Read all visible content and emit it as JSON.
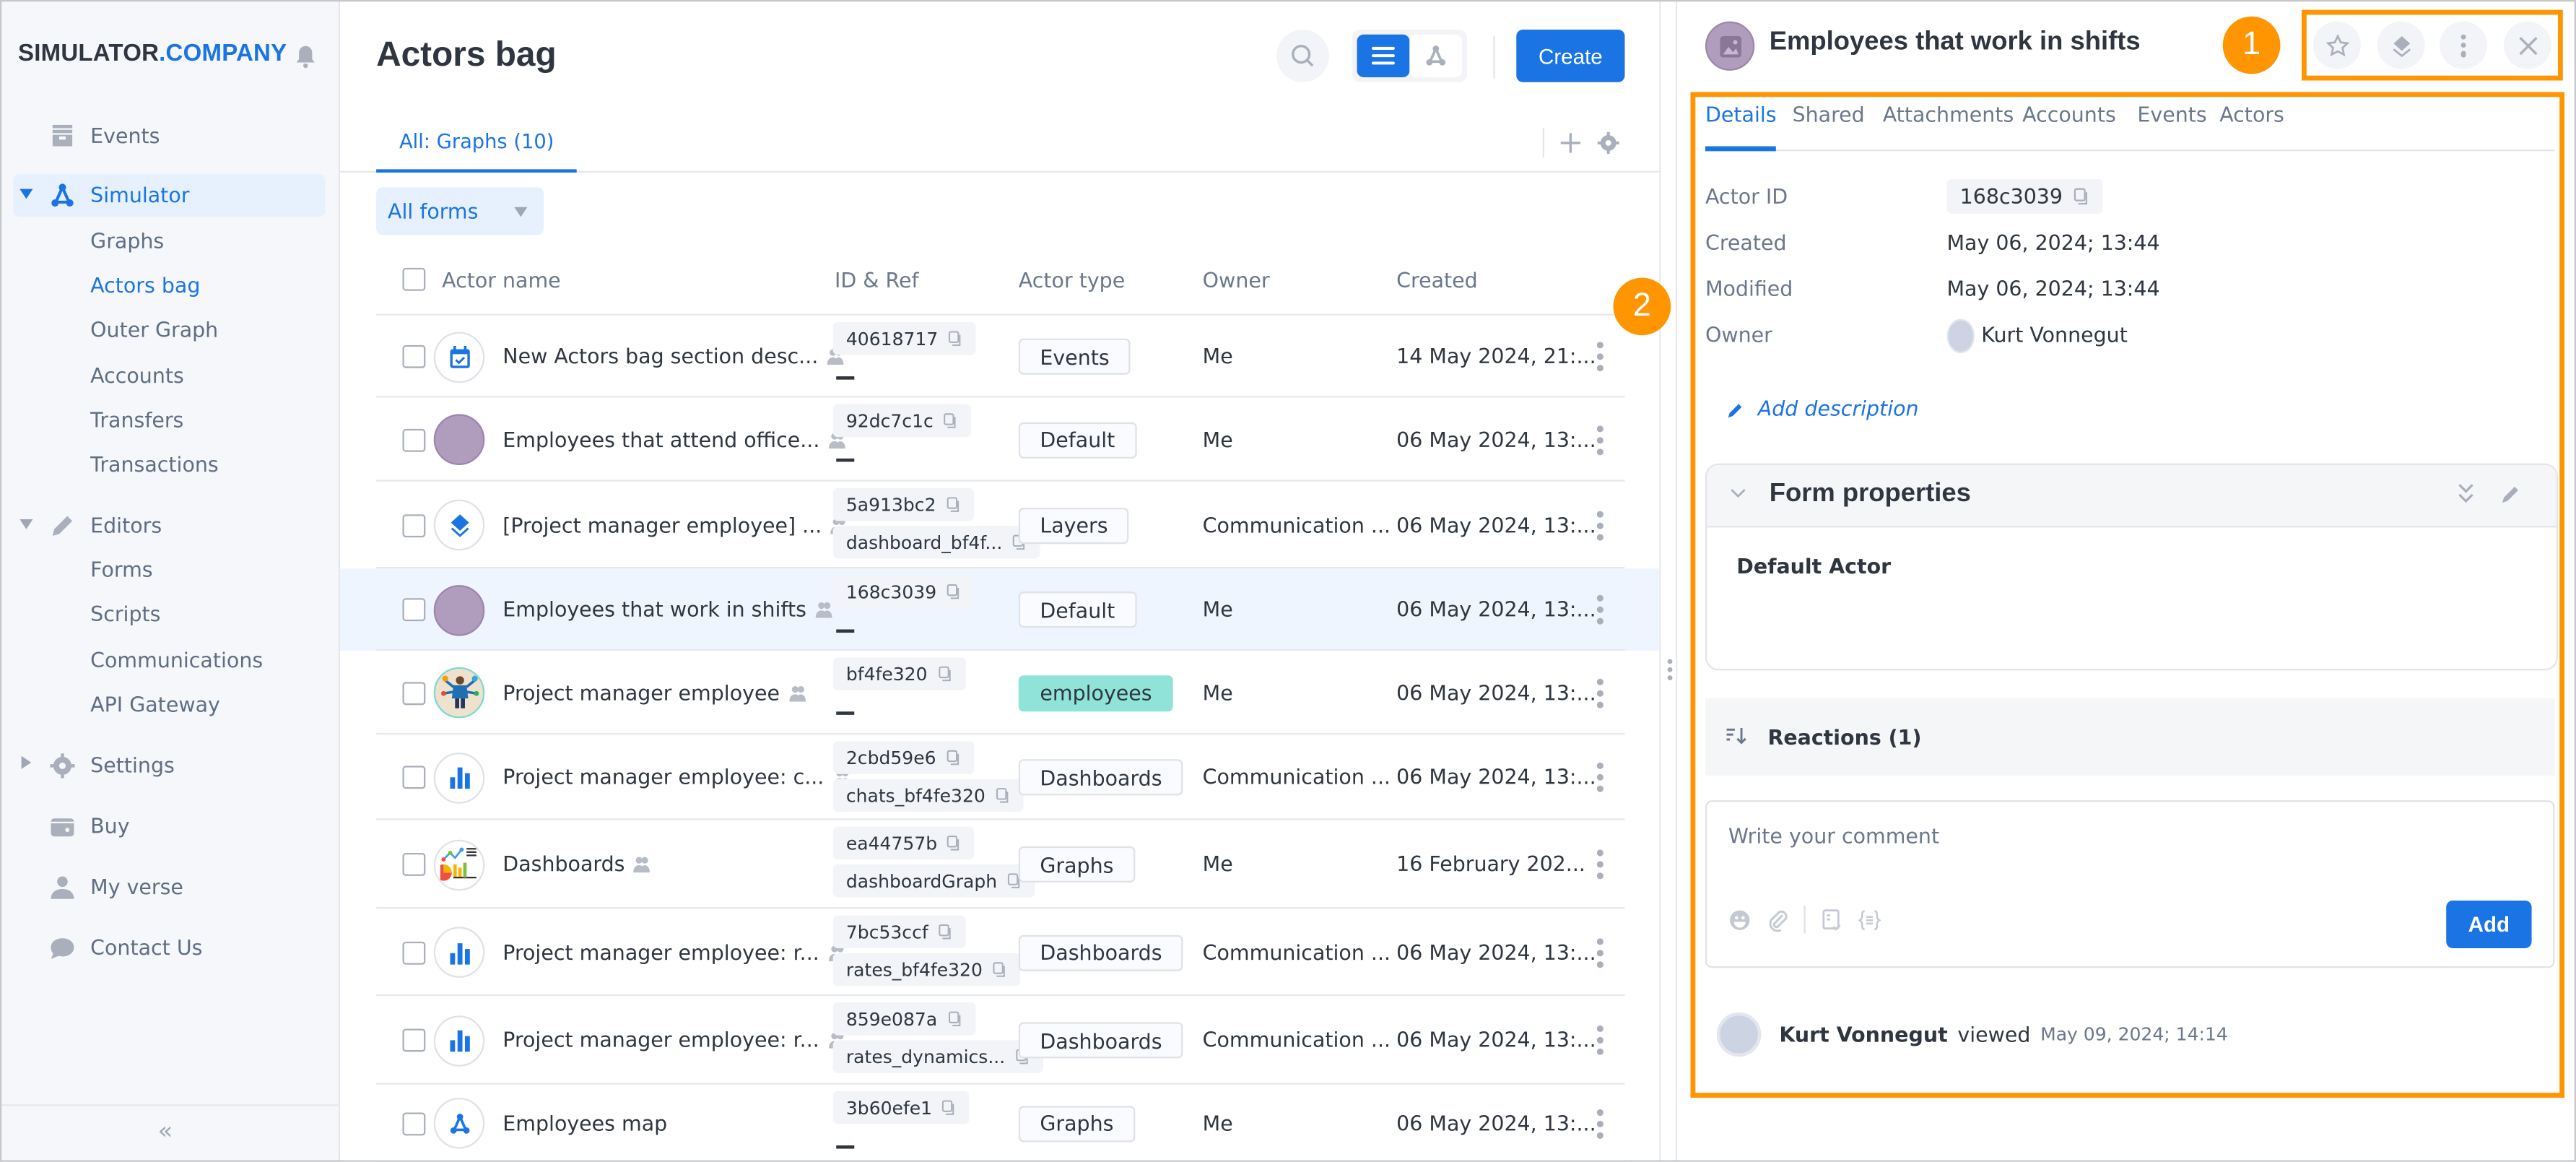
{
  "brand": {
    "part1": "SIMULATOR",
    "part2": ".COMPANY"
  },
  "sidebar": {
    "items": [
      {
        "label": "Events",
        "icon": "inbox-icon"
      },
      {
        "label": "Simulator",
        "icon": "graph-icon",
        "expanded": true,
        "active": true,
        "children": [
          "Graphs",
          "Actors bag",
          "Outer Graph",
          "Accounts",
          "Transfers",
          "Transactions"
        ]
      },
      {
        "label": "Editors",
        "icon": "pencil-icon",
        "expanded": true,
        "children": [
          "Forms",
          "Scripts",
          "Communications",
          "API Gateway"
        ]
      },
      {
        "label": "Settings",
        "icon": "gear-icon",
        "expanded": false
      },
      {
        "label": "Buy",
        "icon": "wallet-icon"
      },
      {
        "label": "My verse",
        "icon": "user-icon"
      },
      {
        "label": "Contact Us",
        "icon": "chat-icon"
      }
    ],
    "active_child": "Actors bag",
    "collapse_label": "«"
  },
  "main": {
    "title": "Actors bag",
    "create_label": "Create",
    "tab_label": "All: Graphs (10)",
    "filter_value": "All forms",
    "columns": [
      "Actor name",
      "ID & Ref",
      "Actor type",
      "Owner",
      "Created"
    ],
    "rows": [
      {
        "name": "New Actors bag section desc...",
        "avatar": "calendar-check-icon",
        "id": "40618717",
        "ref": "—",
        "type": "Events",
        "owner": "Me",
        "created": "14 May 2024, 21:..."
      },
      {
        "name": "Employees that attend office...",
        "avatar": "purple-circle",
        "id": "92dc7c1c",
        "ref": "—",
        "type": "Default",
        "owner": "Me",
        "created": "06 May 2024, 13:..."
      },
      {
        "name": "[Project manager employee] ...",
        "avatar": "layers-icon",
        "id": "5a913bc2",
        "ref": "dashboard_bf4f...",
        "type": "Layers",
        "owner": "Communication ...",
        "created": "06 May 2024, 13:..."
      },
      {
        "name": "Employees that work in shifts",
        "avatar": "purple-circle",
        "id": "168c3039",
        "ref": "—",
        "type": "Default",
        "owner": "Me",
        "created": "06 May 2024, 13:...",
        "selected": true
      },
      {
        "name": "Project manager employee",
        "avatar": "project-manager-image",
        "id": "bf4fe320",
        "ref": "—",
        "type": "employees",
        "type_highlight": true,
        "owner": "Me",
        "created": "06 May 2024, 13:..."
      },
      {
        "name": "Project manager employee: c...",
        "avatar": "bar-chart-icon",
        "id": "2cbd59e6",
        "ref": "chats_bf4fe320",
        "type": "Dashboards",
        "owner": "Communication ...",
        "created": "06 May 2024, 13:..."
      },
      {
        "name": "Dashboards",
        "avatar": "dashboards-image",
        "id": "ea44757b",
        "ref": "dashboardGraph",
        "type": "Graphs",
        "owner": "Me",
        "created": "16 February 202..."
      },
      {
        "name": "Project manager employee: r...",
        "avatar": "bar-chart-icon",
        "id": "7bc53ccf",
        "ref": "rates_bf4fe320",
        "type": "Dashboards",
        "owner": "Communication ...",
        "created": "06 May 2024, 13:..."
      },
      {
        "name": "Project manager employee: r...",
        "avatar": "bar-chart-icon",
        "id": "859e087a",
        "ref": "rates_dynamics...",
        "type": "Dashboards",
        "owner": "Communication ...",
        "created": "06 May 2024, 13:..."
      },
      {
        "name": "Employees map",
        "avatar": "graph-icon",
        "id": "3b60efe1",
        "ref": "—",
        "type": "Graphs",
        "owner": "Me",
        "created": "06 May 2024, 13:..."
      }
    ]
  },
  "panel": {
    "title": "Employees that work in shifts",
    "tabs": [
      "Details",
      "Shared",
      "Attachments",
      "Accounts",
      "Events",
      "Actors"
    ],
    "active_tab": "Details",
    "details": {
      "actor_id_label": "Actor ID",
      "actor_id": "168c3039",
      "created_label": "Created",
      "created": "May 06, 2024; 13:44",
      "modified_label": "Modified",
      "modified": "May 06, 2024; 13:44",
      "owner_label": "Owner",
      "owner": "Kurt Vonnegut"
    },
    "add_description": "Add description",
    "form_properties_title": "Form properties",
    "form_properties_value": "Default Actor",
    "reactions_label": "Reactions (1)",
    "comment_placeholder": "Write your comment",
    "add_label": "Add",
    "activity": {
      "who": "Kurt Vonnegut",
      "verb": "viewed",
      "when": "May 09, 2024; 14:14"
    }
  },
  "annotations": {
    "badge1": "1",
    "badge2": "2",
    "highlight_color": "#ff9500"
  },
  "colors": {
    "accent": "#1b74e4",
    "highlight": "#ff9500",
    "teal_tag": "#8fe3d9"
  }
}
